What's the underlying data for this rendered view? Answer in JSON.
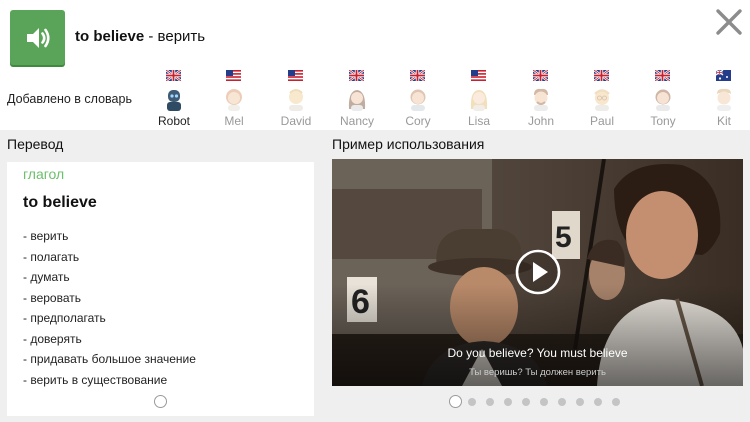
{
  "header": {
    "word": "to believe",
    "separator": " - ",
    "translation": "верить"
  },
  "icons": {
    "sound": "speaker-icon",
    "close": "close-icon"
  },
  "voices": {
    "label": "Добавлено в словарь",
    "selected": "Robot",
    "items": [
      {
        "name": "Robot",
        "flag": "uk"
      },
      {
        "name": "Mel",
        "flag": "us"
      },
      {
        "name": "David",
        "flag": "us"
      },
      {
        "name": "Nancy",
        "flag": "uk"
      },
      {
        "name": "Cory",
        "flag": "uk"
      },
      {
        "name": "Lisa",
        "flag": "us"
      },
      {
        "name": "John",
        "flag": "uk"
      },
      {
        "name": "Paul",
        "flag": "uk"
      },
      {
        "name": "Tony",
        "flag": "uk"
      },
      {
        "name": "Kit",
        "flag": "au"
      }
    ]
  },
  "translation_panel": {
    "title": "Перевод",
    "part_of_speech": "глагол",
    "headword": "to believe",
    "meanings": [
      "- верить",
      "- полагать",
      "- думать",
      "- веровать",
      "- предполагать",
      "- доверять",
      "- придавать большое значение",
      "- верить в существование"
    ],
    "pages": 1,
    "current_page": 1
  },
  "example_panel": {
    "title": "Пример использования",
    "subtitle_en": "Do you believe? You must believe",
    "subtitle_ru": "Ты веришь? Ты должен верить",
    "video_sign_numbers": [
      "6",
      "5"
    ],
    "pages": 10,
    "current_page": 1
  },
  "colors": {
    "accent_green": "#5aa45a",
    "part_of_speech": "#6cbf6c",
    "background": "#efefef"
  }
}
